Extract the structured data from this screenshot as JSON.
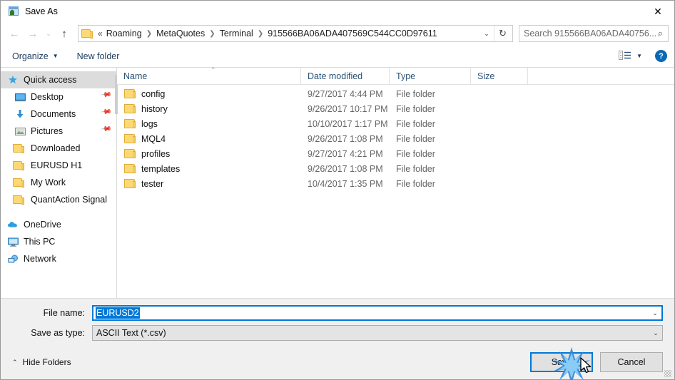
{
  "window": {
    "title": "Save As",
    "app_icon": "save-as-icon",
    "close_label": "✕"
  },
  "nav": {
    "back_icon": "arrow-left-icon",
    "forward_icon": "arrow-right-icon",
    "recent_icon": "chevron-down-icon",
    "up_icon": "arrow-up-icon",
    "back_glyph": "←",
    "forward_glyph": "→",
    "recent_glyph": "⌄",
    "up_glyph": "↑"
  },
  "address": {
    "folder_icon": "folder-icon",
    "overflow": "«",
    "crumbs": [
      "Roaming",
      "MetaQuotes",
      "Terminal",
      "915566BA06ADA407569C544CC0D97611"
    ],
    "separator": "❯",
    "dropdown_glyph": "⌄",
    "refresh_glyph": "↻"
  },
  "search": {
    "placeholder": "Search 915566BA06ADA40756...",
    "value": "",
    "icon_glyph": "⌕"
  },
  "toolbar": {
    "organize_label": "Organize",
    "organize_caret": "▼",
    "new_folder_label": "New folder",
    "view_icon": "list-view-icon",
    "view_caret": "▼",
    "help_label": "?"
  },
  "sidebar": {
    "scroll_present": true,
    "groups": [
      {
        "items": [
          {
            "label": "Quick access",
            "icon": "star-pin-icon",
            "selected": true,
            "pinned": false,
            "root": true
          },
          {
            "label": "Desktop",
            "icon": "desktop-icon",
            "selected": false,
            "pinned": true,
            "root": false
          },
          {
            "label": "Documents",
            "icon": "documents-download-icon",
            "selected": false,
            "pinned": true,
            "root": false
          },
          {
            "label": "Pictures",
            "icon": "pictures-icon",
            "selected": false,
            "pinned": true,
            "root": false
          },
          {
            "label": "Downloaded",
            "icon": "folder-icon",
            "selected": false,
            "pinned": false,
            "root": false
          },
          {
            "label": "EURUSD H1",
            "icon": "folder-icon",
            "selected": false,
            "pinned": false,
            "root": false
          },
          {
            "label": "My Work",
            "icon": "folder-icon",
            "selected": false,
            "pinned": false,
            "root": false
          },
          {
            "label": "QuantAction Signal",
            "icon": "folder-icon",
            "selected": false,
            "pinned": false,
            "root": false
          }
        ]
      },
      {
        "items": [
          {
            "label": "OneDrive",
            "icon": "onedrive-cloud-icon",
            "selected": false,
            "pinned": false,
            "root": true
          },
          {
            "label": "This PC",
            "icon": "this-pc-icon",
            "selected": false,
            "pinned": false,
            "root": true
          },
          {
            "label": "Network",
            "icon": "network-icon",
            "selected": false,
            "pinned": false,
            "root": true
          }
        ]
      }
    ]
  },
  "filelist": {
    "columns": [
      "Name",
      "Date modified",
      "Type",
      "Size"
    ],
    "sort_column": "Name",
    "sort_glyph": "⌃",
    "rows": [
      {
        "name": "config",
        "date": "9/27/2017 4:44 PM",
        "type": "File folder",
        "size": "",
        "icon": "folder-icon"
      },
      {
        "name": "history",
        "date": "9/26/2017 10:17 PM",
        "type": "File folder",
        "size": "",
        "icon": "folder-icon"
      },
      {
        "name": "logs",
        "date": "10/10/2017 1:17 PM",
        "type": "File folder",
        "size": "",
        "icon": "folder-icon"
      },
      {
        "name": "MQL4",
        "date": "9/26/2017 1:08 PM",
        "type": "File folder",
        "size": "",
        "icon": "folder-icon"
      },
      {
        "name": "profiles",
        "date": "9/27/2017 4:21 PM",
        "type": "File folder",
        "size": "",
        "icon": "folder-icon"
      },
      {
        "name": "templates",
        "date": "9/26/2017 1:08 PM",
        "type": "File folder",
        "size": "",
        "icon": "folder-icon"
      },
      {
        "name": "tester",
        "date": "10/4/2017 1:35 PM",
        "type": "File folder",
        "size": "",
        "icon": "folder-icon"
      }
    ]
  },
  "form": {
    "filename_label": "File name:",
    "filename_value": "EURUSD2",
    "filename_selected": true,
    "filetype_label": "Save as type:",
    "filetype_value": "ASCII Text (*.csv)",
    "caret_glyph": "⌄"
  },
  "footer": {
    "hide_folders_label": "Hide Folders",
    "hide_folders_caret": "⌃",
    "save_label": "Save",
    "cancel_label": "Cancel",
    "default_button": "Save"
  },
  "pointer": {
    "cursor_icon": "mouse-arrow-cursor",
    "click_effect": "blue-starburst",
    "target": "save-button"
  },
  "colors": {
    "accent": "#0078d7",
    "selection": "#0078d7",
    "folder_yellow": "#fcd975",
    "dialog_bg": "#f0f0f0",
    "crumb_text": "#1f1f1f",
    "help_blue": "#0a69b5"
  }
}
